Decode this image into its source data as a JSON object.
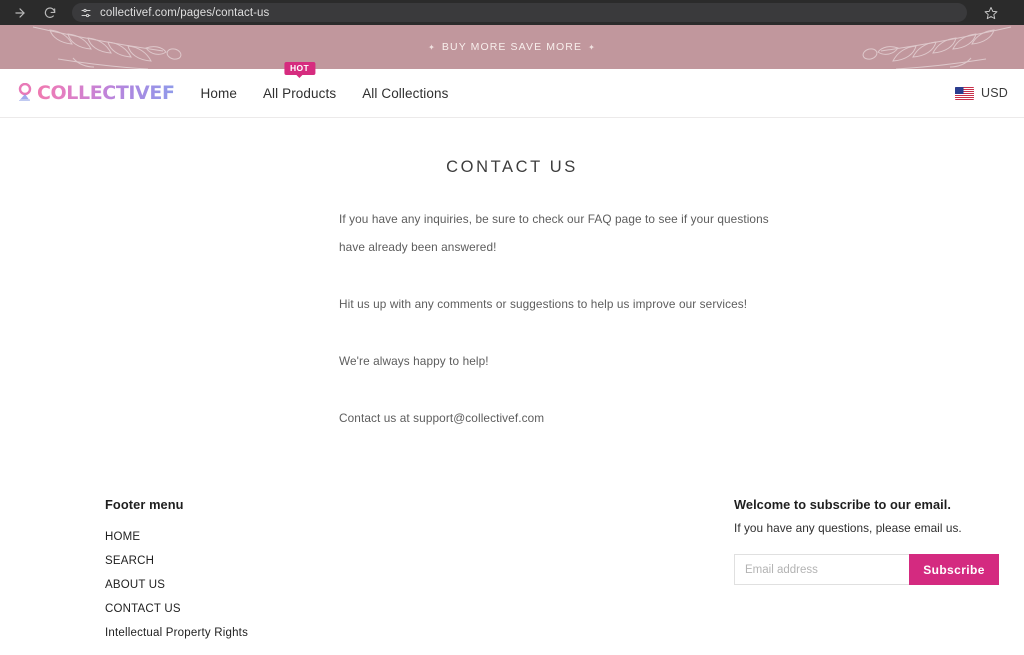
{
  "browser": {
    "forward_icon": "arrow-forward-icon",
    "reload_icon": "reload-icon",
    "site_settings_icon": "tune-icon",
    "url": "collectivef.com/pages/contact-us",
    "bookmark_icon": "star-icon"
  },
  "promo": {
    "text": "BUY MORE SAVE MORE",
    "spark_left": "✦",
    "spark_right": "✦",
    "background": "#c1979d"
  },
  "header": {
    "logo_text": "COLLECTIVEF",
    "logo_mark": "flower-logo-icon",
    "nav": [
      {
        "label": "Home",
        "badge": ""
      },
      {
        "label": "All Products",
        "badge": "HOT"
      },
      {
        "label": "All Collections",
        "badge": ""
      }
    ],
    "currency": {
      "flag": "us-flag-icon",
      "label": "USD"
    },
    "badge_color": "#d62c7f"
  },
  "main": {
    "title": "CONTACT US",
    "paragraphs": [
      "If you have any inquiries, be sure to check our FAQ page to see if your questions",
      "have already been answered!",
      "Hit us up with any comments or suggestions to help us improve our services!",
      "We're always happy to help!",
      "Contact us at support@collectivef.com"
    ]
  },
  "footer": {
    "menu_heading": "Footer menu",
    "links": [
      "HOME",
      "SEARCH",
      "ABOUT US",
      "CONTACT US",
      "Intellectual Property Rights"
    ],
    "newsletter": {
      "title": "Welcome to subscribe to our email.",
      "subtitle": "If you have any questions, please email us.",
      "email_placeholder": "Email address",
      "email_value": "",
      "button_label": "Subscribe",
      "button_color": "#d42a80"
    }
  }
}
